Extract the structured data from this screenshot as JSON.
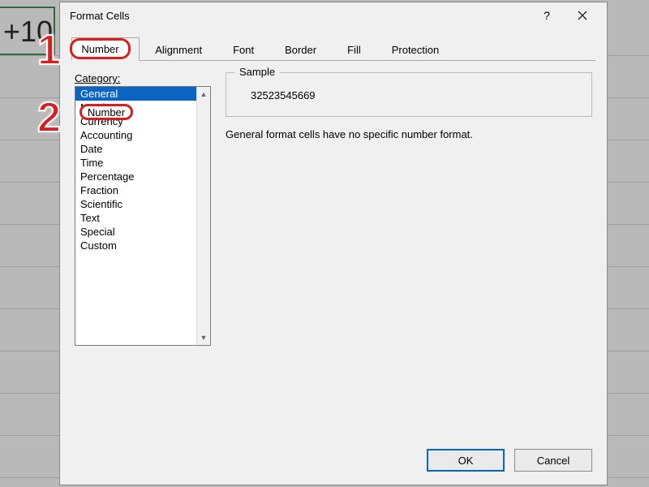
{
  "spreadsheet": {
    "partial_cell_value": "+10"
  },
  "dialog": {
    "title": "Format Cells",
    "help_symbol": "?",
    "tabs": {
      "number": "Number",
      "alignment": "Alignment",
      "font": "Font",
      "border": "Border",
      "fill": "Fill",
      "protection": "Protection"
    },
    "category_label": "Category:",
    "categories": {
      "general": "General",
      "number": "Number",
      "currency": "Currency",
      "accounting": "Accounting",
      "date": "Date",
      "time": "Time",
      "percentage": "Percentage",
      "fraction": "Fraction",
      "scientific": "Scientific",
      "text": "Text",
      "special": "Special",
      "custom": "Custom"
    },
    "sample_label": "Sample",
    "sample_value": "32523545669",
    "description": "General format cells have no specific number format.",
    "ok_label": "OK",
    "cancel_label": "Cancel"
  },
  "callouts": {
    "one": "1",
    "two": "2",
    "one_label": "Number",
    "two_label": "Number"
  }
}
